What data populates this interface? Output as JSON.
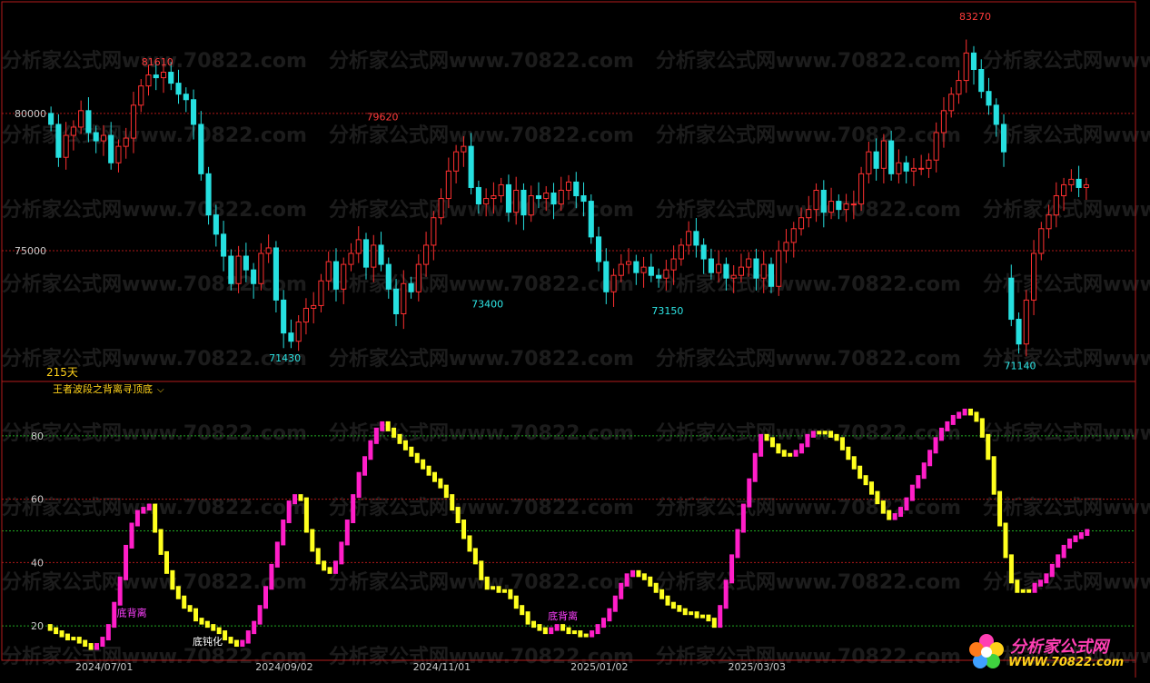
{
  "watermark": "分析家公式网www.70822.com",
  "main_panel": {
    "days_label": "215天"
  },
  "indicator_name": "王者波段之背离寻顶底",
  "annotations": [
    {
      "text": "底背离",
      "x": 13,
      "y": 23
    },
    {
      "text": "底背离",
      "x": 87,
      "y": 22
    },
    {
      "text": "底钝化",
      "x": 26,
      "y": 14
    }
  ],
  "logo": {
    "line1": "分析家公式网",
    "line2": "WWW.70822.com"
  },
  "colors": {
    "up": "#ff3030",
    "down": "#26e0e0",
    "rise_bar": "#ff1ec8",
    "fall_bar": "#ffff1e",
    "grid_red": "#b01818",
    "grid_green": "#22aa22"
  },
  "chart_data": [
    {
      "type": "candlestick",
      "y_ticks": [
        80000,
        75000
      ],
      "x_tick_labels": [
        {
          "x": 7,
          "label": "2024/07/01"
        },
        {
          "x": 31,
          "label": "2024/09/02"
        },
        {
          "x": 52,
          "label": "2024/11/01"
        },
        {
          "x": 73,
          "label": "2025/01/02"
        },
        {
          "x": 94,
          "label": "2025/03/03"
        }
      ],
      "close": [
        79600,
        78400,
        79200,
        79500,
        80100,
        79300,
        79000,
        79200,
        78200,
        78800,
        79100,
        80300,
        81000,
        81400,
        81300,
        81500,
        81100,
        80700,
        80500,
        79600,
        77800,
        76300,
        75600,
        74800,
        73800,
        74800,
        74300,
        73800,
        74900,
        75100,
        73200,
        72000,
        71700,
        72400,
        72900,
        73000,
        73900,
        74600,
        73600,
        74500,
        74900,
        75400,
        74400,
        75200,
        74500,
        73600,
        72700,
        73800,
        73500,
        74500,
        75200,
        76200,
        76900,
        77900,
        78600,
        78800,
        77300,
        76700,
        76900,
        77000,
        77400,
        76400,
        77200,
        76300,
        77000,
        76900,
        77100,
        76700,
        77200,
        77500,
        77000,
        76800,
        75500,
        74600,
        73500,
        74100,
        74500,
        74600,
        74200,
        74400,
        74100,
        74000,
        74300,
        74700,
        75200,
        75700,
        75200,
        74700,
        74200,
        74500,
        74000,
        74100,
        74400,
        74700,
        74000,
        74500,
        73700,
        75000,
        75300,
        75800,
        76200,
        76500,
        77200,
        76400,
        76800,
        76500,
        76700,
        76700,
        77800,
        78600,
        78000,
        79000,
        77800,
        78200,
        77900,
        78000,
        78000,
        78300,
        79300,
        80100,
        80700,
        81200,
        82200,
        81600,
        80800,
        80300,
        79600,
        78600,
        72500,
        71600,
        73200,
        74900,
        75800,
        76300,
        77000,
        77400,
        77600,
        77300,
        77400
      ],
      "open": [
        80000,
        79600,
        78400,
        79200,
        79500,
        80100,
        79300,
        79000,
        79200,
        78200,
        78800,
        79100,
        80300,
        81000,
        81400,
        81300,
        81500,
        81100,
        80700,
        80500,
        79600,
        77800,
        76300,
        75600,
        74800,
        73800,
        74800,
        74300,
        73800,
        74900,
        75100,
        73200,
        72000,
        71700,
        72400,
        72900,
        73000,
        73900,
        74600,
        73600,
        74500,
        74900,
        75400,
        74400,
        75200,
        74500,
        73600,
        72700,
        73800,
        73500,
        74500,
        75200,
        76200,
        76900,
        77900,
        78600,
        78800,
        77300,
        76700,
        76900,
        77000,
        77400,
        76400,
        77200,
        76300,
        77000,
        76900,
        77100,
        76700,
        77200,
        77500,
        77000,
        76800,
        75500,
        74600,
        73500,
        74100,
        74500,
        74600,
        74200,
        74400,
        74100,
        74000,
        74300,
        74700,
        75200,
        75700,
        75200,
        74700,
        74200,
        74500,
        74000,
        74100,
        74400,
        74700,
        74000,
        74500,
        73700,
        75000,
        75300,
        75800,
        76200,
        76500,
        77200,
        76400,
        76800,
        76500,
        76700,
        76700,
        77800,
        78600,
        78000,
        79000,
        77800,
        78200,
        77900,
        78000,
        78000,
        78300,
        79300,
        80100,
        80700,
        81200,
        82200,
        81600,
        80800,
        80300,
        79600,
        74000,
        72500,
        71600,
        73200,
        74900,
        75800,
        76300,
        77000,
        77400,
        77600,
        77300
      ],
      "highs_labeled": [
        {
          "x": 14,
          "label": "81610"
        },
        {
          "x": 44,
          "label": "79620"
        },
        {
          "x": 123,
          "label": "83270"
        }
      ],
      "lows_labeled": [
        {
          "x": 31,
          "label": "71430"
        },
        {
          "x": 58,
          "label": "73400"
        },
        {
          "x": 82,
          "label": "73150"
        },
        {
          "x": 129,
          "label": "71140"
        }
      ],
      "ylim": [
        70500,
        83800
      ]
    },
    {
      "type": "bar",
      "y_ticks": [
        80,
        60,
        40,
        20
      ],
      "values": [
        19,
        18,
        17,
        16,
        16,
        15,
        14,
        13,
        14,
        16,
        20,
        27,
        35,
        45,
        52,
        56,
        57,
        58,
        50,
        43,
        37,
        32,
        29,
        26,
        25,
        22,
        21,
        20,
        19,
        18,
        16,
        15,
        14,
        15,
        18,
        21,
        26,
        32,
        39,
        46,
        53,
        59,
        61,
        60,
        50,
        44,
        40,
        38,
        37,
        40,
        46,
        53,
        61,
        68,
        73,
        78,
        82,
        84,
        82,
        80,
        78,
        76,
        74,
        72,
        70,
        68,
        66,
        64,
        61,
        57,
        53,
        48,
        44,
        40,
        35,
        32,
        32,
        31,
        31,
        29,
        26,
        24,
        21,
        20,
        19,
        18,
        19,
        20,
        19,
        18,
        18,
        17,
        17,
        18,
        20,
        22,
        25,
        29,
        33,
        36,
        37,
        36,
        35,
        33,
        31,
        29,
        27,
        26,
        25,
        24,
        24,
        23,
        23,
        22,
        20,
        26,
        34,
        42,
        50,
        58,
        66,
        74,
        80,
        79,
        77,
        75,
        74,
        74,
        75,
        77,
        80,
        81,
        81,
        81,
        80,
        79,
        76,
        73,
        70,
        67,
        65,
        62,
        59,
        56,
        54,
        55,
        57,
        60,
        64,
        67,
        71,
        75,
        79,
        82,
        84,
        86,
        87,
        88,
        87,
        85,
        80,
        73,
        62,
        52,
        42,
        34,
        31,
        31,
        31,
        33,
        34,
        36,
        39,
        42,
        45,
        47,
        48,
        49,
        50
      ],
      "ylim": [
        10,
        92
      ]
    }
  ]
}
